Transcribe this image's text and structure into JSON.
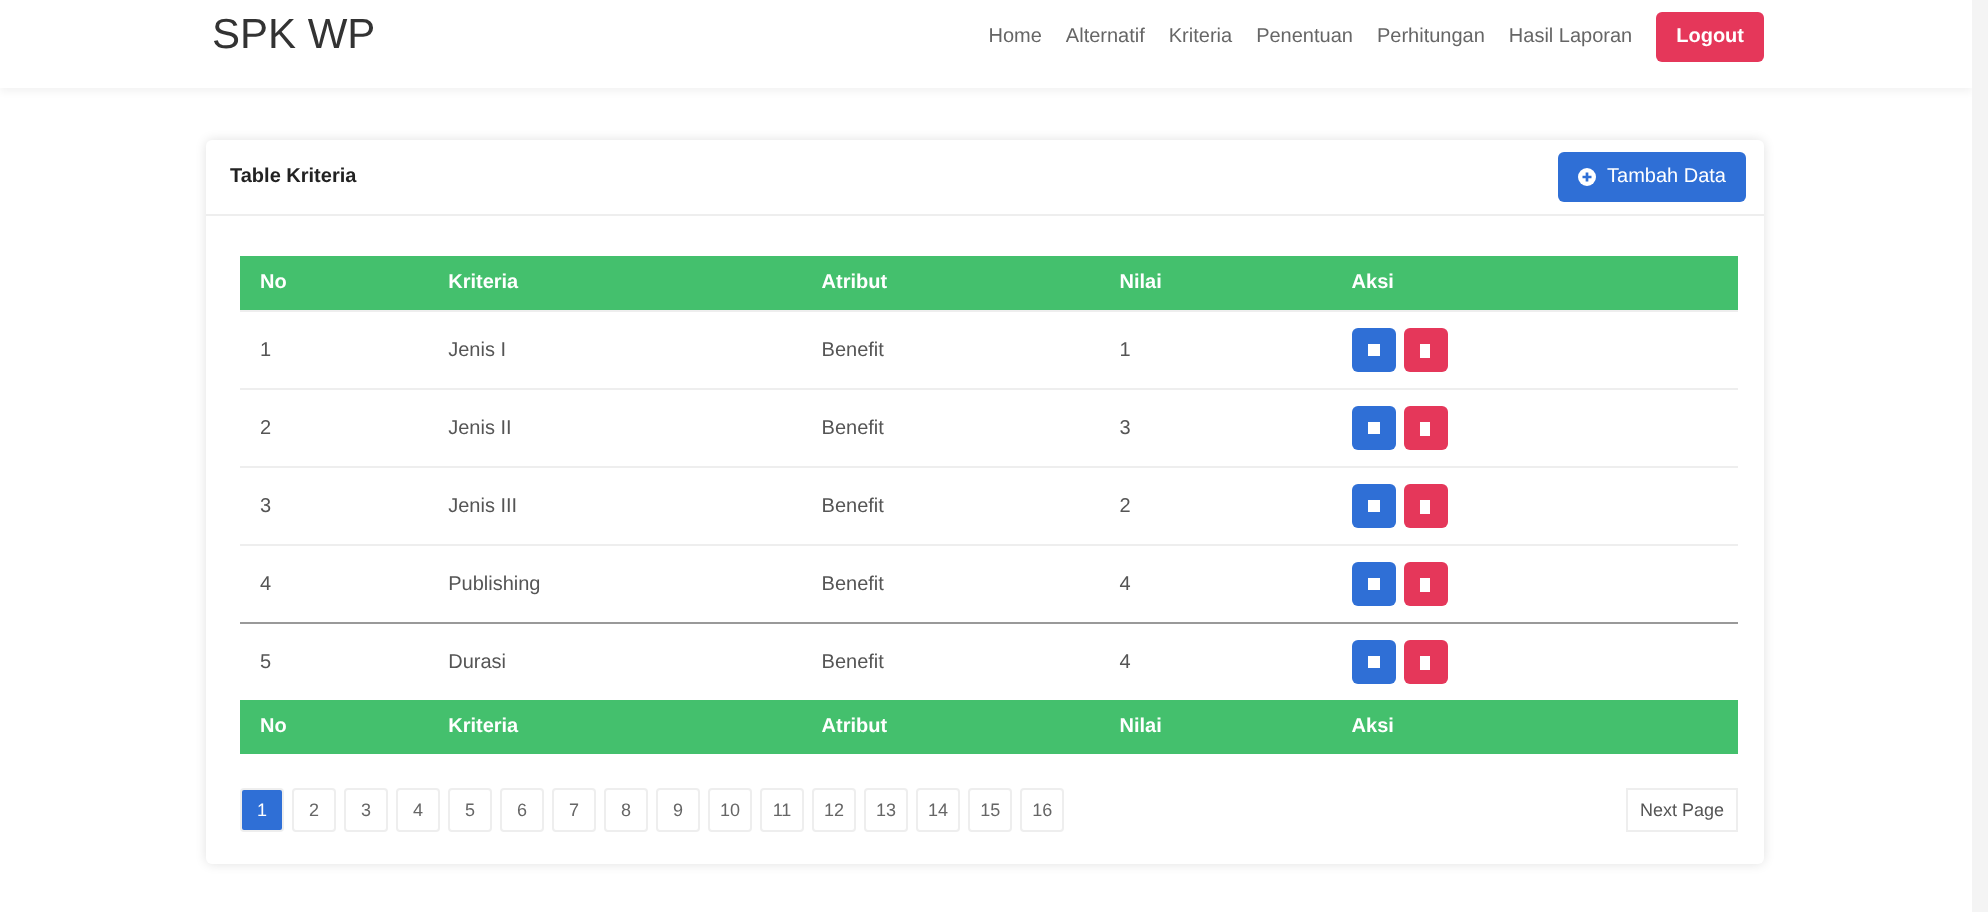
{
  "navbar": {
    "brand": "SPK WP",
    "links": [
      "Home",
      "Alternatif",
      "Kriteria",
      "Penentuan",
      "Perhitungan",
      "Hasil Laporan"
    ],
    "logout": "Logout"
  },
  "card": {
    "title": "Table Kriteria",
    "add_button": "Tambah Data"
  },
  "table": {
    "columns": [
      "No",
      "Kriteria",
      "Atribut",
      "Nilai",
      "Aksi"
    ],
    "footer_columns": [
      "No",
      "Kriteria",
      "Atribut",
      "Nilai",
      "Aksi"
    ],
    "rows": [
      {
        "no": "1",
        "kriteria": "Jenis I",
        "atribut": "Benefit",
        "nilai": "1"
      },
      {
        "no": "2",
        "kriteria": "Jenis II",
        "atribut": "Benefit",
        "nilai": "3"
      },
      {
        "no": "3",
        "kriteria": "Jenis III",
        "atribut": "Benefit",
        "nilai": "2"
      },
      {
        "no": "4",
        "kriteria": "Publishing",
        "atribut": "Benefit",
        "nilai": "4"
      },
      {
        "no": "5",
        "kriteria": "Durasi",
        "atribut": "Benefit",
        "nilai": "4"
      }
    ]
  },
  "pagination": {
    "pages": [
      {
        "label": "1",
        "selected": true
      },
      {
        "label": "2",
        "selected": false
      },
      {
        "label": "3",
        "selected": false
      },
      {
        "label": "4",
        "selected": false
      },
      {
        "label": "5",
        "selected": false
      },
      {
        "label": "6",
        "selected": false
      },
      {
        "label": "7",
        "selected": false
      },
      {
        "label": "8",
        "selected": false
      },
      {
        "label": "9",
        "selected": false
      },
      {
        "label": "10",
        "selected": false
      },
      {
        "label": "11",
        "selected": false
      },
      {
        "label": "12",
        "selected": false
      },
      {
        "label": "13",
        "selected": false
      },
      {
        "label": "14",
        "selected": false
      },
      {
        "label": "15",
        "selected": false
      },
      {
        "label": "16",
        "selected": false
      }
    ],
    "next": "Next Page"
  }
}
